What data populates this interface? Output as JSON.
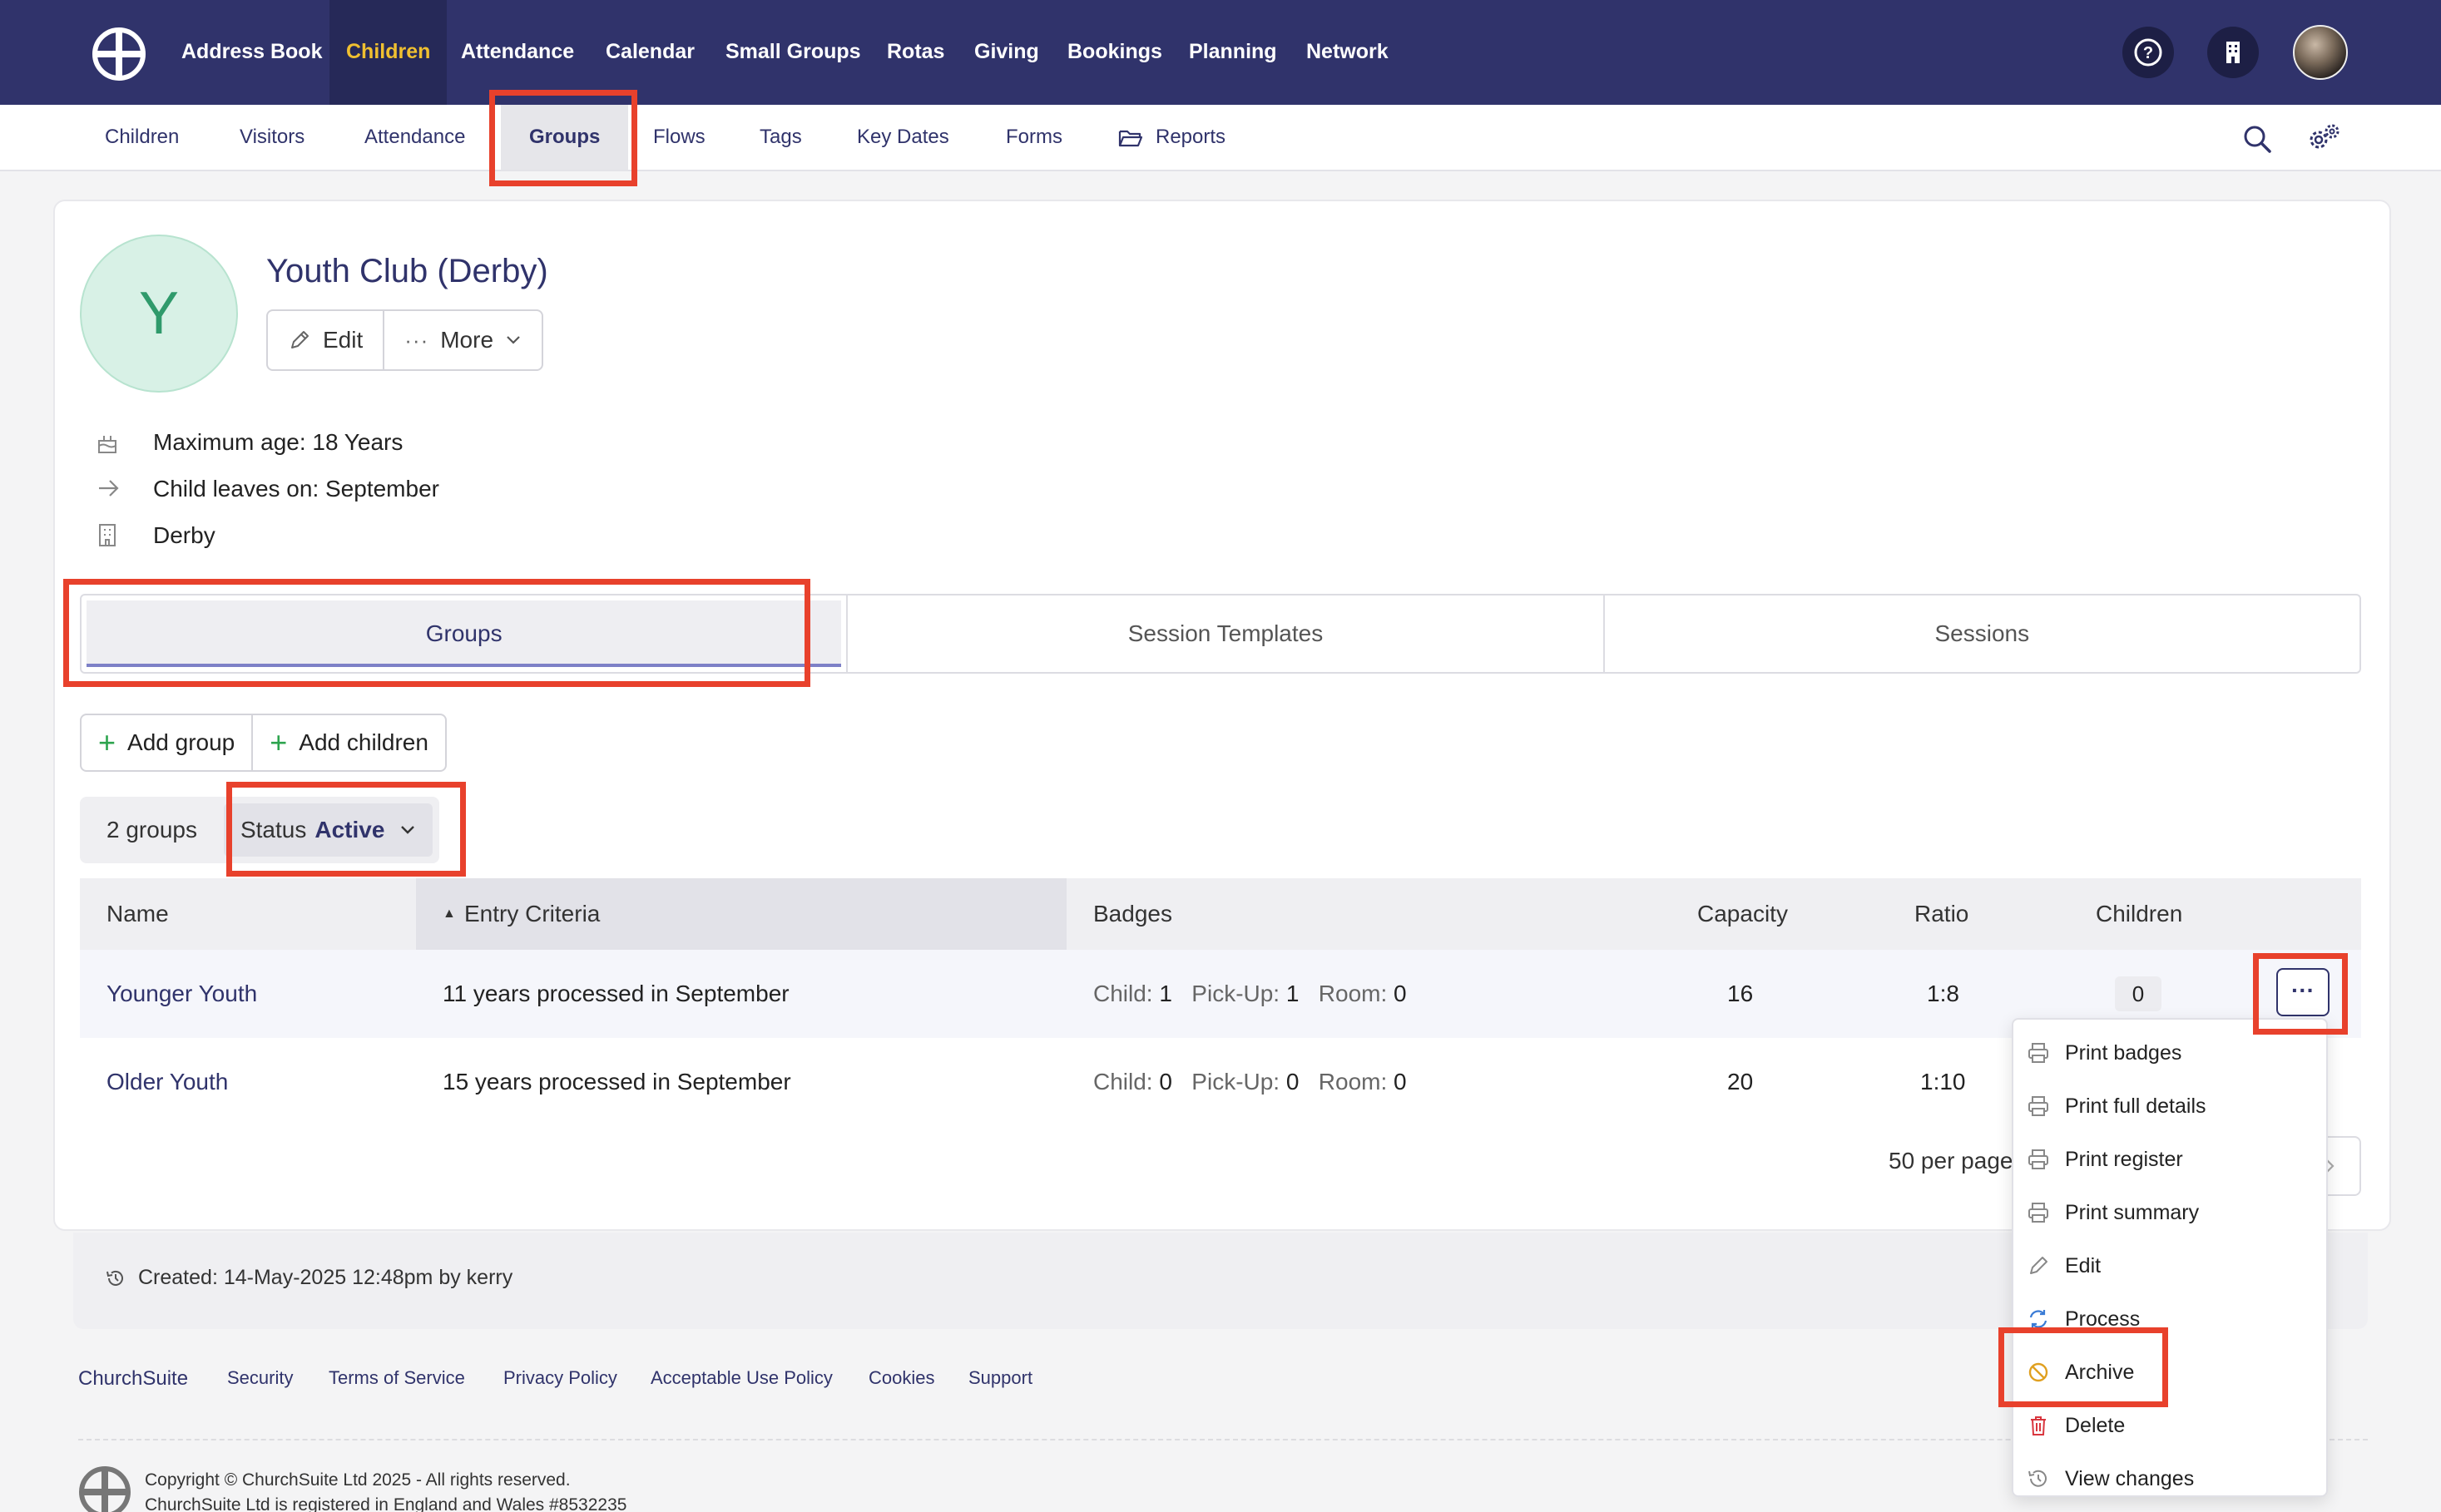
{
  "topnav": {
    "items": [
      "Address Book",
      "Children",
      "Attendance",
      "Calendar",
      "Small Groups",
      "Rotas",
      "Giving",
      "Bookings",
      "Planning",
      "Network"
    ],
    "active": "Children"
  },
  "subnav": {
    "items": [
      "Children",
      "Visitors",
      "Attendance",
      "Groups",
      "Flows",
      "Tags",
      "Key Dates",
      "Forms",
      "Reports"
    ],
    "active": "Groups"
  },
  "group": {
    "initial": "Y",
    "title": "Youth Club (Derby)",
    "edit_label": "Edit",
    "more_label": "More",
    "max_age": "Maximum age: 18 Years",
    "leaves_on": "Child leaves on: September",
    "site": "Derby"
  },
  "tabs": [
    "Groups",
    "Session Templates",
    "Sessions"
  ],
  "actions": {
    "add_group": "Add group",
    "add_children": "Add children"
  },
  "filters": {
    "count": "2 groups",
    "status_label": "Status",
    "status_value": "Active"
  },
  "table": {
    "headers": [
      "Name",
      "Entry Criteria",
      "Badges",
      "Capacity",
      "Ratio",
      "Children"
    ],
    "badge_labels": {
      "child": "Child:",
      "pickup": "Pick-Up:",
      "room": "Room:"
    },
    "rows": [
      {
        "name": "Younger Youth",
        "criteria": "11 years processed in September",
        "child": "1",
        "pickup": "1",
        "room": "0",
        "capacity": "16",
        "ratio": "1:8",
        "children": "0"
      },
      {
        "name": "Older Youth",
        "criteria": "15 years processed in September",
        "child": "0",
        "pickup": "0",
        "room": "0",
        "capacity": "20",
        "ratio": "1:10",
        "children": ""
      }
    ],
    "per_page": "50 per page"
  },
  "row_menu": {
    "items": [
      "Print badges",
      "Print full details",
      "Print register",
      "Print summary",
      "Edit",
      "Process",
      "Archive",
      "Delete",
      "View changes"
    ]
  },
  "created": "Created: 14-May-2025 12:48pm by kerry",
  "footer": {
    "links": [
      "ChurchSuite",
      "Security",
      "Terms of Service",
      "Privacy Policy",
      "Acceptable Use Policy",
      "Cookies",
      "Support"
    ],
    "copyright": "Copyright © ChurchSuite Ltd 2025 - All rights reserved.",
    "registered": "ChurchSuite Ltd is registered in England and Wales #8532235"
  },
  "colors": {
    "brand": "#30336b",
    "active_nav": "#f0c030",
    "highlight": "#e8412c",
    "add": "#2da44e"
  }
}
